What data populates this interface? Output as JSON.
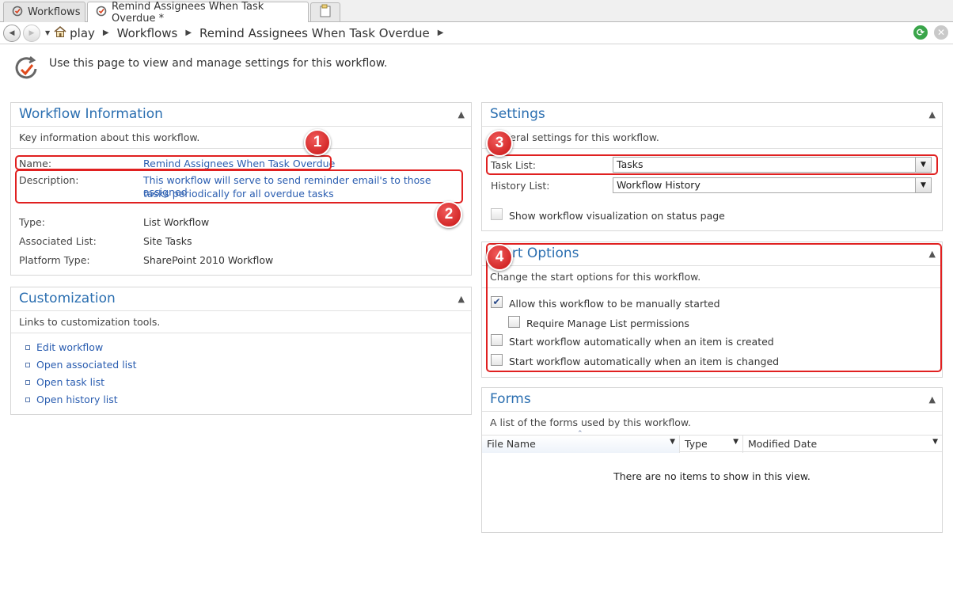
{
  "tabs": [
    {
      "label": "Workflows",
      "icon": "workflow-icon"
    },
    {
      "label": "Remind Assignees When Task Overdue *",
      "icon": "workflow-icon"
    }
  ],
  "breadcrumb": [
    "play",
    "Workflows",
    "Remind Assignees When Task Overdue"
  ],
  "intro": "Use this page to view and manage settings for this workflow.",
  "workflow_info": {
    "title": "Workflow Information",
    "subtitle": "Key information about this workflow.",
    "name_label": "Name:",
    "name_value": "Remind Assignees When Task Overdue",
    "description_label": "Description:",
    "description_line1": "This workflow will serve to send reminder email's to those assigned",
    "description_line2": "tasks periodically for all overdue tasks",
    "type_label": "Type:",
    "type_value": "List Workflow",
    "list_label": "Associated List:",
    "list_value": "Site Tasks",
    "platform_label": "Platform Type:",
    "platform_value": "SharePoint 2010 Workflow"
  },
  "customization": {
    "title": "Customization",
    "subtitle": "Links to customization tools.",
    "links": [
      "Edit workflow",
      "Open associated list",
      "Open task list",
      "Open history list"
    ]
  },
  "settings": {
    "title": "Settings",
    "subtitle": "General settings for this workflow.",
    "task_list_label": "Task List:",
    "task_list_value": "Tasks",
    "history_list_label": "History List:",
    "history_list_value": "Workflow History",
    "show_visualization": "Show workflow visualization on status page"
  },
  "start_options": {
    "title": "Start Options",
    "subtitle": "Change the start options for this workflow.",
    "manual": "Allow this workflow to be manually started",
    "manual_checked": true,
    "require_manage": "Require Manage List permissions",
    "on_create": "Start workflow automatically when an item is created",
    "on_change": "Start workflow automatically when an item is changed"
  },
  "forms": {
    "title": "Forms",
    "subtitle": "A list of the forms used by this workflow.",
    "columns": [
      "File Name",
      "Type",
      "Modified Date"
    ],
    "empty": "There are no items to show in this view."
  },
  "callouts": [
    "1",
    "2",
    "3",
    "4"
  ],
  "colors": {
    "accent": "#2a6eb0",
    "callout": "#e02020",
    "link": "#2a5db0"
  }
}
